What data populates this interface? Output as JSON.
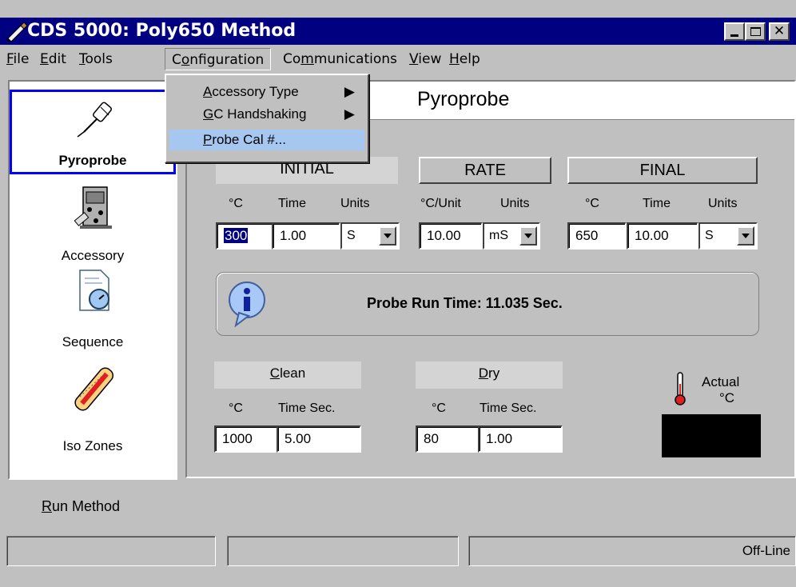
{
  "window": {
    "title": "CDS 5000: Poly650 Method",
    "icons": {
      "app": "pen-icon",
      "minimize": "minimize-icon",
      "maximize": "maximize-icon",
      "close": "close-icon"
    }
  },
  "menubar": {
    "items": [
      {
        "pre": "",
        "ul": "F",
        "post": "ile"
      },
      {
        "pre": "",
        "ul": "E",
        "post": "dit"
      },
      {
        "pre": "",
        "ul": "T",
        "post": "ools"
      },
      {
        "pre": "C",
        "ul": "o",
        "post": "nfiguration"
      },
      {
        "pre": "Co",
        "ul": "m",
        "post": "munications"
      },
      {
        "pre": "",
        "ul": "V",
        "post": "iew"
      },
      {
        "pre": "",
        "ul": "H",
        "post": "elp"
      }
    ]
  },
  "dropdown": {
    "items": [
      {
        "ul": "A",
        "post": "ccessory Type",
        "submenu": "▶"
      },
      {
        "ul": "G",
        "post": "C Handshaking",
        "submenu": "▶"
      },
      {
        "ul": "P",
        "post": "robe Cal #...",
        "submenu": ""
      }
    ]
  },
  "sidebar": {
    "items": [
      {
        "label": "Pyroprobe",
        "icon": "pyroprobe-icon"
      },
      {
        "label": "Accessory",
        "icon": "accessory-icon"
      },
      {
        "label": "Sequence",
        "icon": "sequence-icon"
      },
      {
        "label": "Iso Zones",
        "icon": "iso-zones-icon"
      }
    ]
  },
  "main": {
    "title": "Pyroprobe",
    "initial": {
      "label": "INITIAL",
      "cols": [
        "°C",
        "Time",
        "Units"
      ],
      "temp": "300",
      "time": "1.00",
      "units": "S"
    },
    "rate": {
      "label": "RATE",
      "cols": [
        "°C/Unit",
        "Units"
      ],
      "value": "10.00",
      "units": "mS"
    },
    "final": {
      "label": "FINAL",
      "cols": [
        "°C",
        "Time",
        "Units"
      ],
      "temp": "650",
      "time": "10.00",
      "units": "S"
    },
    "info": {
      "text": "Probe Run Time: 11.035 Sec.",
      "icon": "info-icon"
    },
    "clean": {
      "ul": "C",
      "post": "lean",
      "cols": [
        "°C",
        "Time Sec."
      ],
      "temp": "1000",
      "time": "5.00"
    },
    "dry": {
      "ul": "D",
      "post": "ry",
      "cols": [
        "°C",
        "Time Sec."
      ],
      "temp": "80",
      "time": "1.00"
    },
    "actual": {
      "label": "Actual",
      "unit": "°C",
      "icon": "thermometer-icon"
    }
  },
  "run_button": {
    "ul": "R",
    "post": "un Method"
  },
  "statusbar": {
    "right": "Off-Line"
  }
}
